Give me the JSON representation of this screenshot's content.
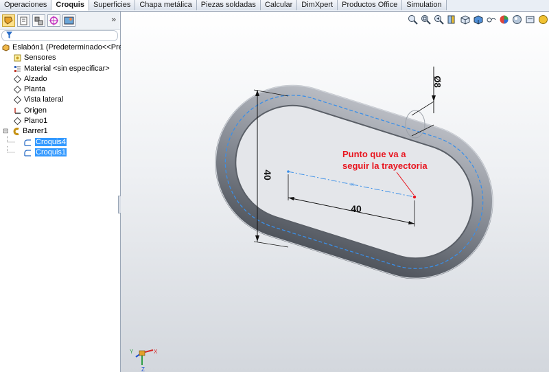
{
  "tabs": [
    "Operaciones",
    "Croquis",
    "Superficies",
    "Chapa metálica",
    "Piezas soldadas",
    "Calcular",
    "DimXpert",
    "Productos Office",
    "Simulation"
  ],
  "active_tab": "Croquis",
  "tree": {
    "root": "Eslabón1  (Predeterminado<<Prec",
    "sensors": "Sensores",
    "material": "Material <sin especificar>",
    "alzado": "Alzado",
    "planta": "Planta",
    "vista_lateral": "Vista lateral",
    "origen": "Origen",
    "plano1": "Plano1",
    "barrer1": "Barrer1",
    "croquis4": "Croquis4",
    "croquis1": "Croquis1"
  },
  "panel": {
    "expand": "»"
  },
  "viewport": {
    "dim_vertical": "40",
    "dim_horizontal": "40",
    "dim_diameter": "Ø8",
    "annotation_line1": "Punto que va a",
    "annotation_line2": "seguir la trayectoria",
    "annotation_color": "#e8141e",
    "sketch_color": "#3a8fe8",
    "part_color": "#8e939c"
  },
  "triad": {
    "x": "X",
    "y": "Y",
    "z": "Z"
  }
}
